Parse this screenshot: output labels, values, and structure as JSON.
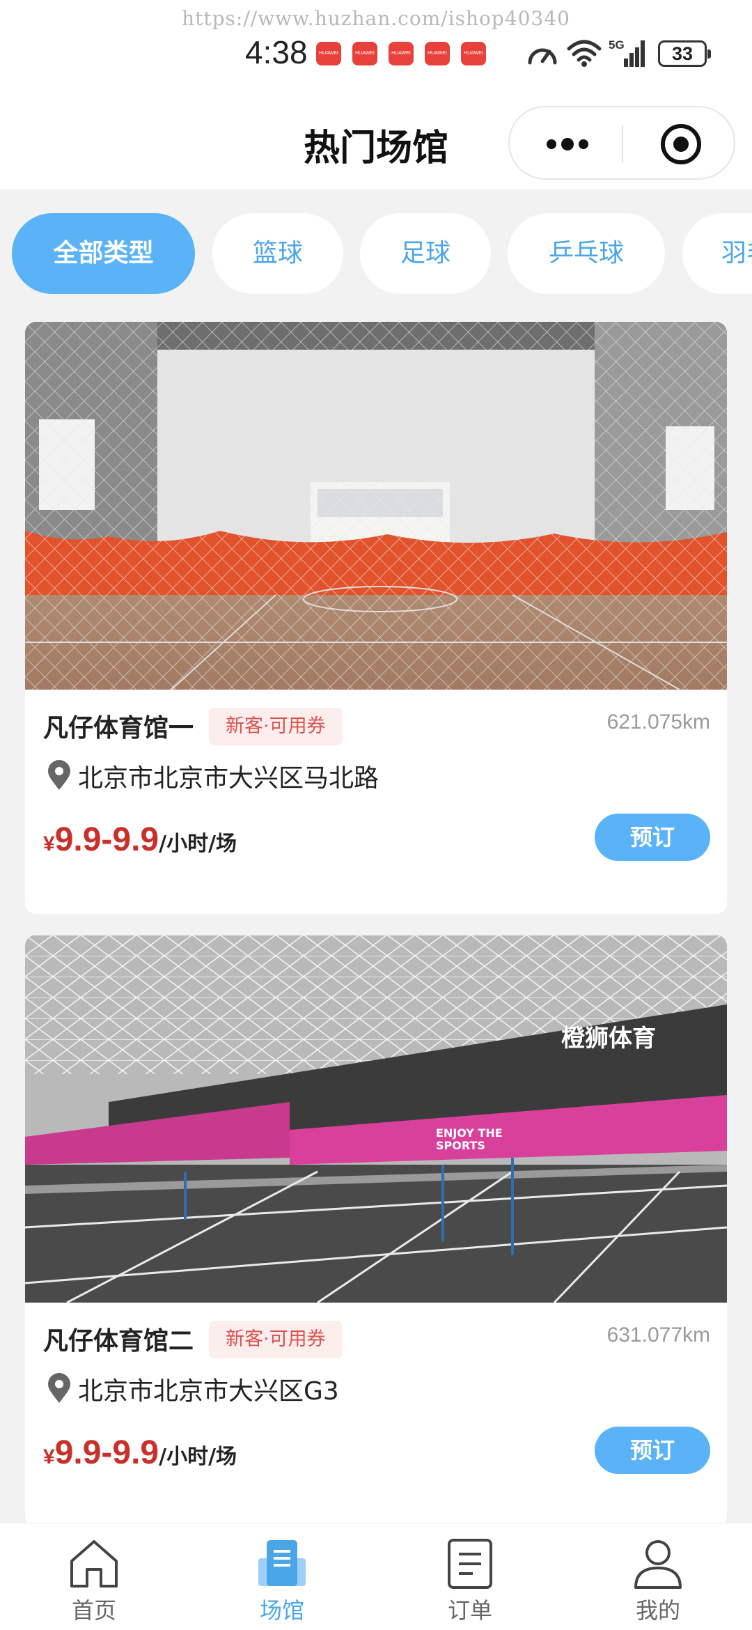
{
  "status_bar": {
    "watermark": "https://www.huzhan.com/ishop40340",
    "time": "4:38",
    "notification_label": "HUAWEI",
    "battery": "33"
  },
  "nav": {
    "title": "热门场馆"
  },
  "categories": [
    {
      "label": "全部类型",
      "active": true
    },
    {
      "label": "篮球",
      "active": false
    },
    {
      "label": "足球",
      "active": false
    },
    {
      "label": "乒乓球",
      "active": false
    },
    {
      "label": "羽毛",
      "active": false
    }
  ],
  "venues": [
    {
      "name": "凡仔体育馆一",
      "badge": "新客·可用券",
      "distance": "621.075km",
      "address": "北京市北京市大兴区马北路",
      "currency": "¥",
      "price": "9.9-9.9",
      "unit": "/小时/场",
      "book_label": "预订"
    },
    {
      "name": "凡仔体育馆二",
      "badge": "新客·可用券",
      "distance": "631.077km",
      "address": "北京市北京市大兴区G3",
      "currency": "¥",
      "price": "9.9-9.9",
      "unit": "/小时/场",
      "book_label": "预订"
    }
  ],
  "photo2_text": {
    "brand": "橙狮体育",
    "slogan_1": "ENJOY THE",
    "slogan_2": "SPORTS"
  },
  "tabbar": [
    {
      "label": "首页",
      "icon": "home-icon",
      "active": false
    },
    {
      "label": "场馆",
      "icon": "venue-icon",
      "active": true
    },
    {
      "label": "订单",
      "icon": "order-icon",
      "active": false
    },
    {
      "label": "我的",
      "icon": "user-icon",
      "active": false
    }
  ],
  "colors": {
    "accent": "#5ab3f6",
    "accent_text": "#4ba6e8",
    "price": "#c9302c",
    "badge_bg": "#fdeeee",
    "badge_text": "#d9534f"
  }
}
